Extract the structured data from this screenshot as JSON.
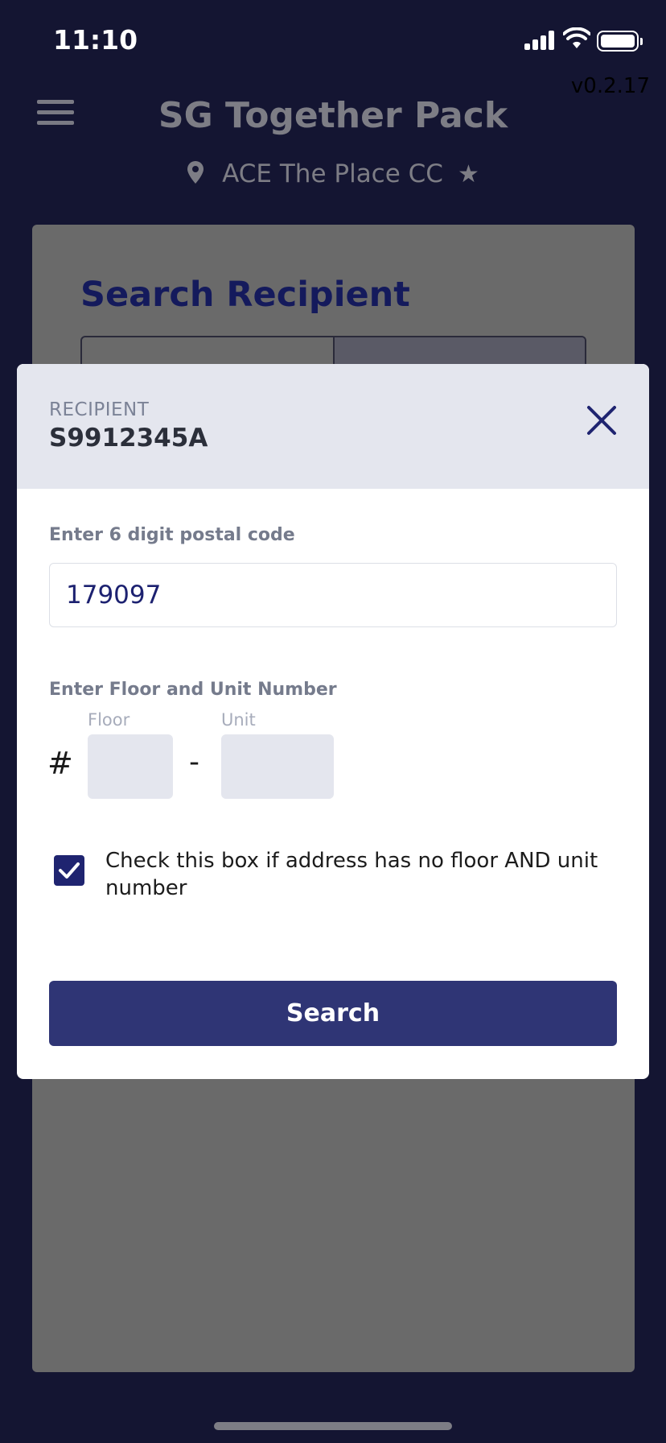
{
  "status_bar": {
    "time": "11:10"
  },
  "header": {
    "version": "v0.2.17",
    "title": "SG Together Pack",
    "location": "ACE The Place CC"
  },
  "background_card": {
    "title": "Search Recipient"
  },
  "modal": {
    "recipient_label": "RECIPIENT",
    "recipient_id": "S9912345A",
    "postal_label": "Enter 6 digit postal code",
    "postal_value": "179097",
    "unit_section_label": "Enter Floor and Unit Number",
    "floor_caption": "Floor",
    "unit_caption": "Unit",
    "hash_symbol": "#",
    "dash_symbol": "-",
    "floor_value": "",
    "unit_value": "",
    "no_floor_checkbox_checked": true,
    "no_floor_checkbox_label": "Check this box if address has no floor AND unit number",
    "search_label": "Search"
  },
  "colors": {
    "page_bg": "#141532",
    "accent": "#2f3575",
    "checkbox": "#1f2470",
    "title_navy": "#141a5c"
  }
}
